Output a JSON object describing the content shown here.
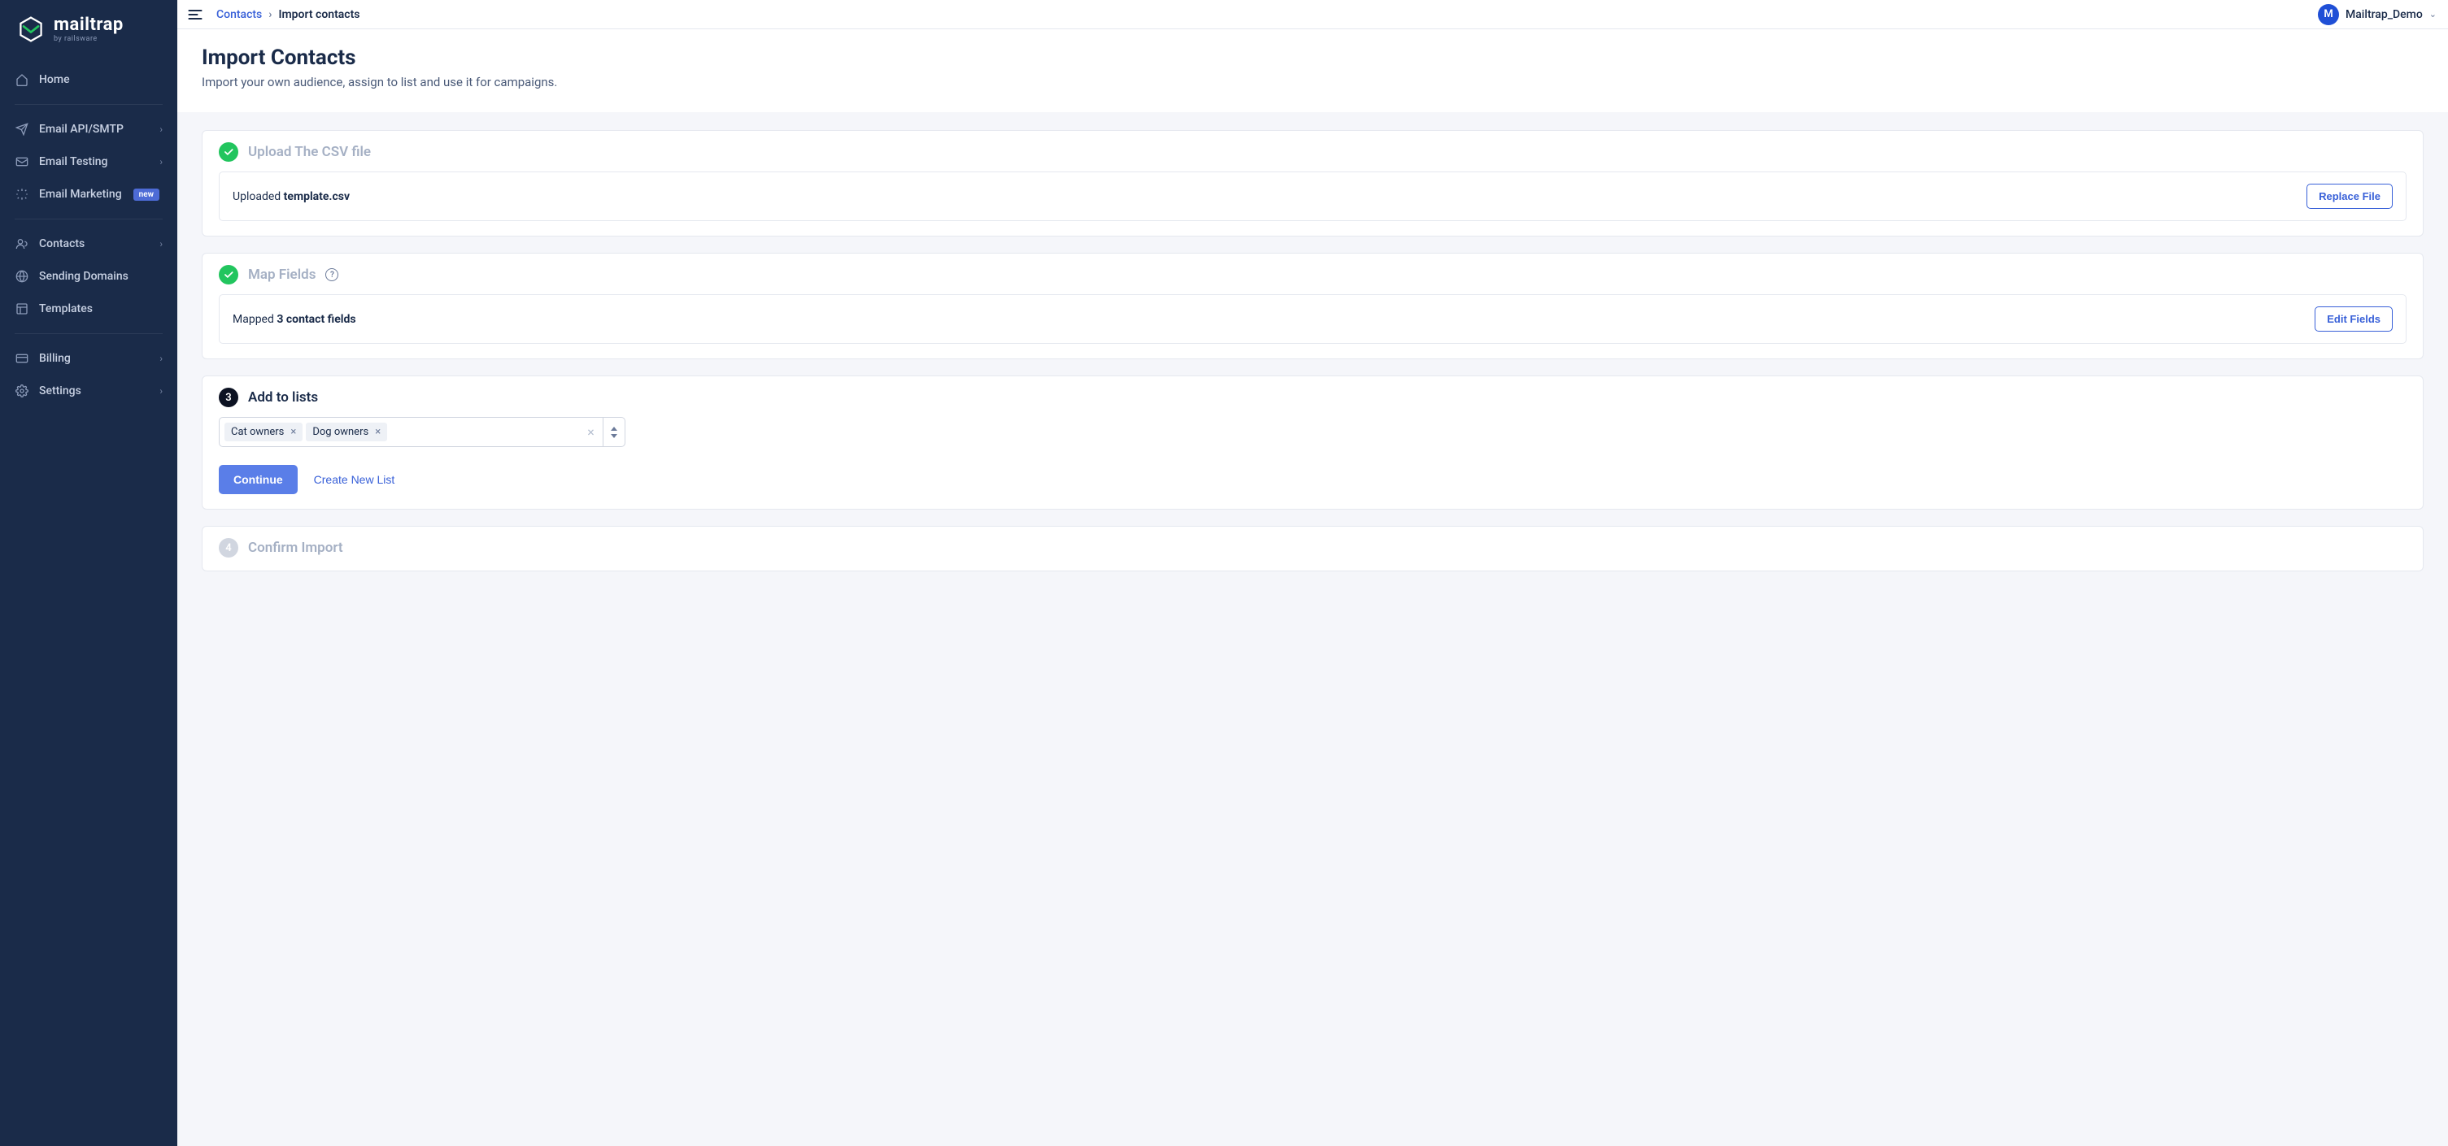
{
  "brand": {
    "name": "mailtrap",
    "byline": "by railsware"
  },
  "sidebar": {
    "items": [
      {
        "label": "Home",
        "icon": "home-icon",
        "chevron": false
      },
      {
        "label": "Email API/SMTP",
        "icon": "send-icon",
        "chevron": true
      },
      {
        "label": "Email Testing",
        "icon": "mail-check-icon",
        "chevron": true
      },
      {
        "label": "Email Marketing",
        "icon": "sparkle-icon",
        "chevron": false,
        "badge": "new"
      },
      {
        "label": "Contacts",
        "icon": "users-icon",
        "chevron": true
      },
      {
        "label": "Sending Domains",
        "icon": "globe-icon",
        "chevron": false
      },
      {
        "label": "Templates",
        "icon": "layout-icon",
        "chevron": false
      },
      {
        "label": "Billing",
        "icon": "card-icon",
        "chevron": true
      },
      {
        "label": "Settings",
        "icon": "gear-icon",
        "chevron": true
      }
    ]
  },
  "breadcrumb": {
    "parent": "Contacts",
    "current": "Import contacts"
  },
  "account": {
    "initial": "M",
    "name": "Mailtrap_Demo"
  },
  "page": {
    "title": "Import Contacts",
    "subtitle": "Import your own audience, assign to list and use it for campaigns."
  },
  "steps": {
    "upload": {
      "title": "Upload The CSV file",
      "summary_prefix": "Uploaded ",
      "summary_bold": "template.csv",
      "action": "Replace File"
    },
    "map": {
      "title": "Map Fields",
      "summary_prefix": "Mapped ",
      "summary_bold": "3 contact fields",
      "action": "Edit Fields"
    },
    "lists": {
      "number": "3",
      "title": "Add to lists",
      "tags": [
        "Cat owners",
        "Dog owners"
      ],
      "continue": "Continue",
      "create": "Create New List"
    },
    "confirm": {
      "number": "4",
      "title": "Confirm Import"
    }
  }
}
